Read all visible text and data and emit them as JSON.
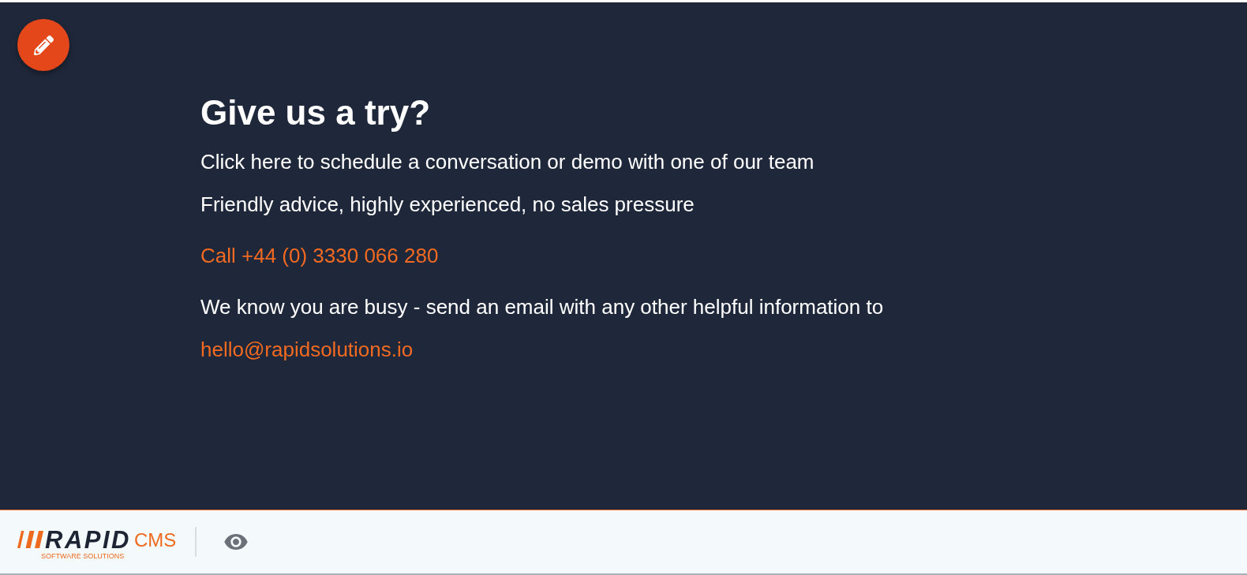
{
  "contact": {
    "heading": "Give us a try?",
    "paragraphs": [
      {
        "lines": [
          {
            "kind": "text",
            "text": "Click here to schedule a conversation or demo with one of our team"
          },
          {
            "kind": "text",
            "text": "Friendly advice, highly experienced, no sales pressure"
          }
        ]
      },
      {
        "lines": [
          {
            "kind": "phone",
            "text": "Call +44 (0) 3330 066 280"
          }
        ]
      },
      {
        "lines": [
          {
            "kind": "text",
            "text": "We know you are busy - send an email with any other helpful information to"
          },
          {
            "kind": "email",
            "text": "hello@rapidsolutions.io"
          }
        ]
      }
    ]
  },
  "footer": {
    "logo": {
      "wordmark": "RAPID",
      "product": "CMS",
      "tagline": "SOFTWARE SOLUTIONS"
    }
  }
}
